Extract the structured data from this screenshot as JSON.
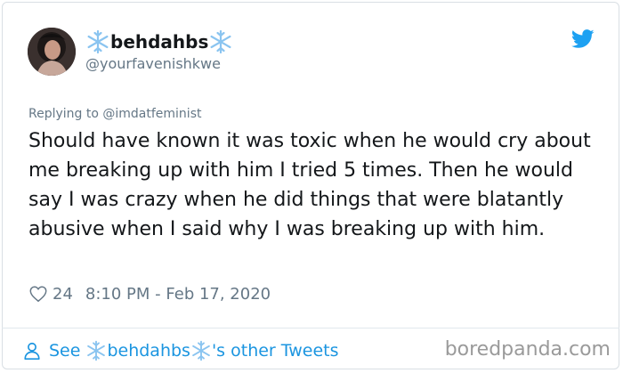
{
  "tweet": {
    "display_name": "behdahbs",
    "handle": "@yourfavenishkwe",
    "replying_to": "Replying to @imdatfeminist",
    "text": "Should have known it was toxic when he would cry about me breaking up with him I tried 5 times. Then he would say I was crazy when he did things that were blatantly abusive when I said why I was breaking up with him.",
    "likes": "24",
    "timestamp": "8:10 PM - Feb 17, 2020"
  },
  "footer": {
    "see_prefix": "See",
    "name": "behdahbs",
    "suffix": "'s other Tweets"
  },
  "watermark": "boredpanda.com",
  "colors": {
    "accent": "#1b95e0",
    "snowflake": "#8ac4f0",
    "text": "#14171a",
    "muted": "#657786"
  },
  "icons": [
    "snowflake-icon",
    "twitter-bird-icon",
    "heart-icon",
    "person-icon"
  ]
}
